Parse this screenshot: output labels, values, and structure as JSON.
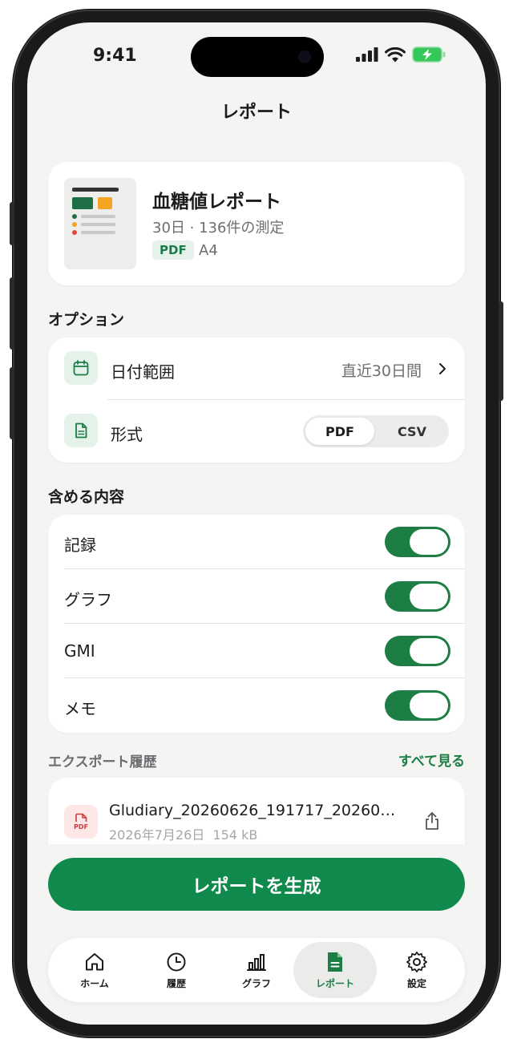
{
  "status": {
    "time": "9:41"
  },
  "header": {
    "title": "レポート"
  },
  "report": {
    "name": "血糖値レポート",
    "meta": "30日 · 136件の測定",
    "format_badge": "PDF",
    "paper_size": "A4"
  },
  "options": {
    "section_title": "オプション",
    "date_range_label": "日付範囲",
    "date_range_value": "直近30日間",
    "format_label": "形式",
    "format_options": [
      "PDF",
      "CSV"
    ],
    "format_selected": "PDF"
  },
  "include": {
    "section_title": "含める内容",
    "items": [
      {
        "label": "記録",
        "enabled": true
      },
      {
        "label": "グラフ",
        "enabled": true
      },
      {
        "label": "GMI",
        "enabled": true
      },
      {
        "label": "メモ",
        "enabled": true
      }
    ]
  },
  "history": {
    "section_title": "エクスポート履歴",
    "see_all": "すべて見る",
    "items": [
      {
        "file_name": "Gludiary_20260626_191717_20260…",
        "date": "2026年7月26日",
        "size": "154 kB",
        "icon_label": "PDF"
      }
    ]
  },
  "actions": {
    "generate": "レポートを生成"
  },
  "tabs": [
    {
      "label": "ホーム",
      "icon": "home-icon",
      "active": false
    },
    {
      "label": "履歴",
      "icon": "clock-icon",
      "active": false
    },
    {
      "label": "グラフ",
      "icon": "bar-chart-icon",
      "active": false
    },
    {
      "label": "レポート",
      "icon": "document-icon",
      "active": true
    },
    {
      "label": "設定",
      "icon": "gear-icon",
      "active": false
    }
  ],
  "colors": {
    "accent": "#0f8a4c",
    "toggle_on": "#1c7d45",
    "background": "#f4f4f2",
    "pdf_red": "#d23b3b"
  }
}
